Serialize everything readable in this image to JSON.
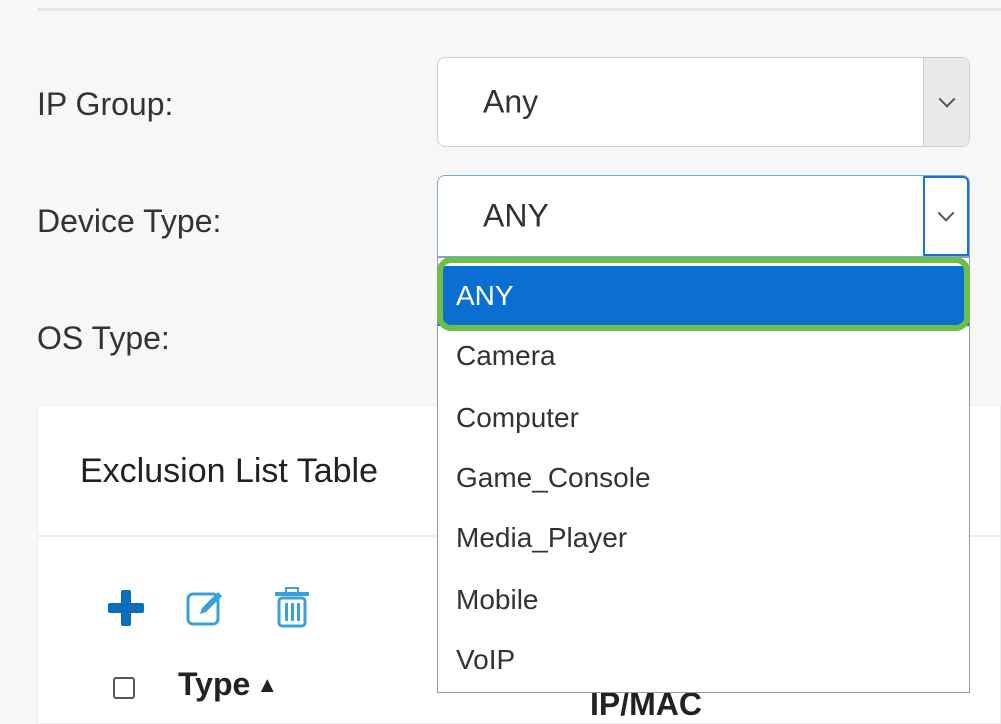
{
  "form": {
    "ip_group": {
      "label": "IP Group:",
      "value": "Any"
    },
    "device_type": {
      "label": "Device Type:",
      "value": "ANY",
      "options": [
        "ANY",
        "Camera",
        "Computer",
        "Game_Console",
        "Media_Player",
        "Mobile",
        "VoIP"
      ],
      "selected_index": 0
    },
    "os_type": {
      "label": "OS Type:"
    }
  },
  "exclusion_table": {
    "title": "Exclusion List Table",
    "toolbar": {
      "add_icon": "plus-icon",
      "edit_icon": "edit-icon",
      "delete_icon": "trash-icon"
    },
    "columns": [
      {
        "label": "Type",
        "sort_icon": "sort-icon"
      },
      {
        "label": "IP/MAC",
        "sort_icon": "sort-icon"
      }
    ]
  },
  "colors": {
    "selected_option": "#0a6fd0",
    "highlight_border": "#6cc04a",
    "icon_blue": "#0a6fb8"
  }
}
